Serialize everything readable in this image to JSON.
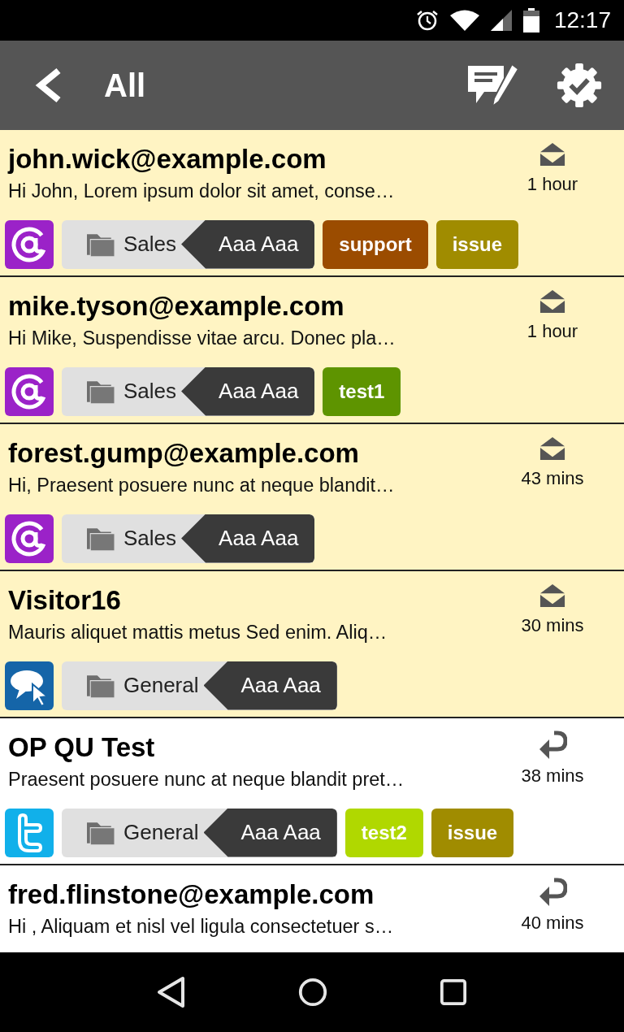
{
  "status_bar": {
    "time": "12:17"
  },
  "header": {
    "title": "All"
  },
  "conversations": [
    {
      "sender": "john.wick@example.com",
      "preview": "Hi John, Lorem ipsum dolor sit amet, conse…",
      "time": "1 hour",
      "unread": true,
      "kind": "email",
      "department": "Sales",
      "agent": "Aaa Aaa",
      "tags": [
        {
          "label": "support",
          "color": "#9b4c00"
        },
        {
          "label": "issue",
          "color": "#a08c00"
        }
      ]
    },
    {
      "sender": "mike.tyson@example.com",
      "preview": "Hi Mike, Suspendisse vitae arcu. Donec pla…",
      "time": "1 hour",
      "unread": true,
      "kind": "email",
      "department": "Sales",
      "agent": "Aaa Aaa",
      "tags": [
        {
          "label": "test1",
          "color": "#5e9400"
        }
      ]
    },
    {
      "sender": "forest.gump@example.com",
      "preview": "Hi, Praesent posuere nunc at neque blandit…",
      "time": "43 mins",
      "unread": true,
      "kind": "email",
      "department": "Sales",
      "agent": "Aaa Aaa"
    },
    {
      "sender": "Visitor16",
      "preview": "Mauris aliquet mattis metus Sed enim. Aliq…",
      "time": "30 mins",
      "unread": true,
      "kind": "chat",
      "department": "General",
      "agent": "Aaa Aaa"
    },
    {
      "sender": "OP QU Test",
      "preview": "Praesent posuere nunc at neque blandit pret…",
      "time": "38 mins",
      "unread": false,
      "kind": "twitter",
      "department": "General",
      "agent": "Aaa Aaa",
      "tags": [
        {
          "label": "test2",
          "color": "#b0d800"
        },
        {
          "label": "issue",
          "color": "#a08c00"
        }
      ]
    },
    {
      "sender": "fred.flinstone@example.com",
      "preview": "Hi , Aliquam et nisl vel ligula consectetuer s…",
      "time": "40 mins",
      "unread": false
    }
  ]
}
